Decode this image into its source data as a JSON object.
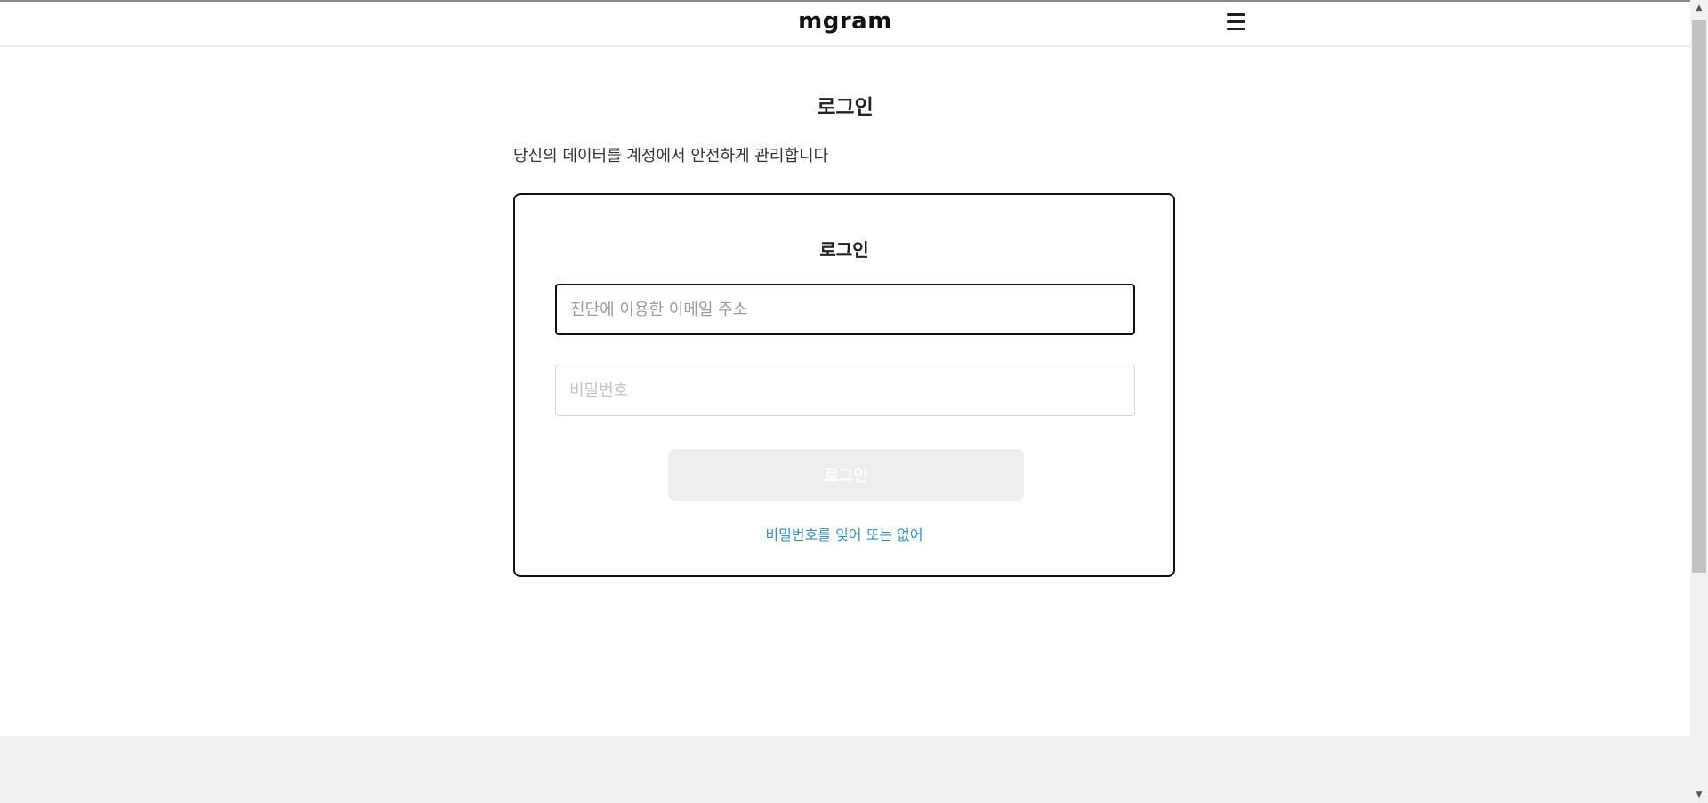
{
  "header": {
    "logo": "mgram",
    "menu_icon": "hamburger-menu-icon"
  },
  "main": {
    "page_title": "로그인",
    "subtitle": "당신의 데이터를 계정에서 안전하게 관리합니다"
  },
  "login_card": {
    "title": "로그인",
    "email_placeholder": "진단에 이용한 이메일 주소",
    "email_value": "",
    "password_placeholder": "비밀번호",
    "password_value": "",
    "login_button_label": "로그인",
    "forgot_link": "비밀번호를 잊어 또는 없어"
  },
  "scrollbar": {
    "up_icon": "scroll-up-arrow-icon",
    "down_icon": "scroll-down-arrow-icon"
  },
  "colors": {
    "link": "#3a8fc2",
    "button_disabled_bg": "#eeeeee",
    "card_border": "#111111",
    "footer_bg": "#f1f1f1"
  }
}
